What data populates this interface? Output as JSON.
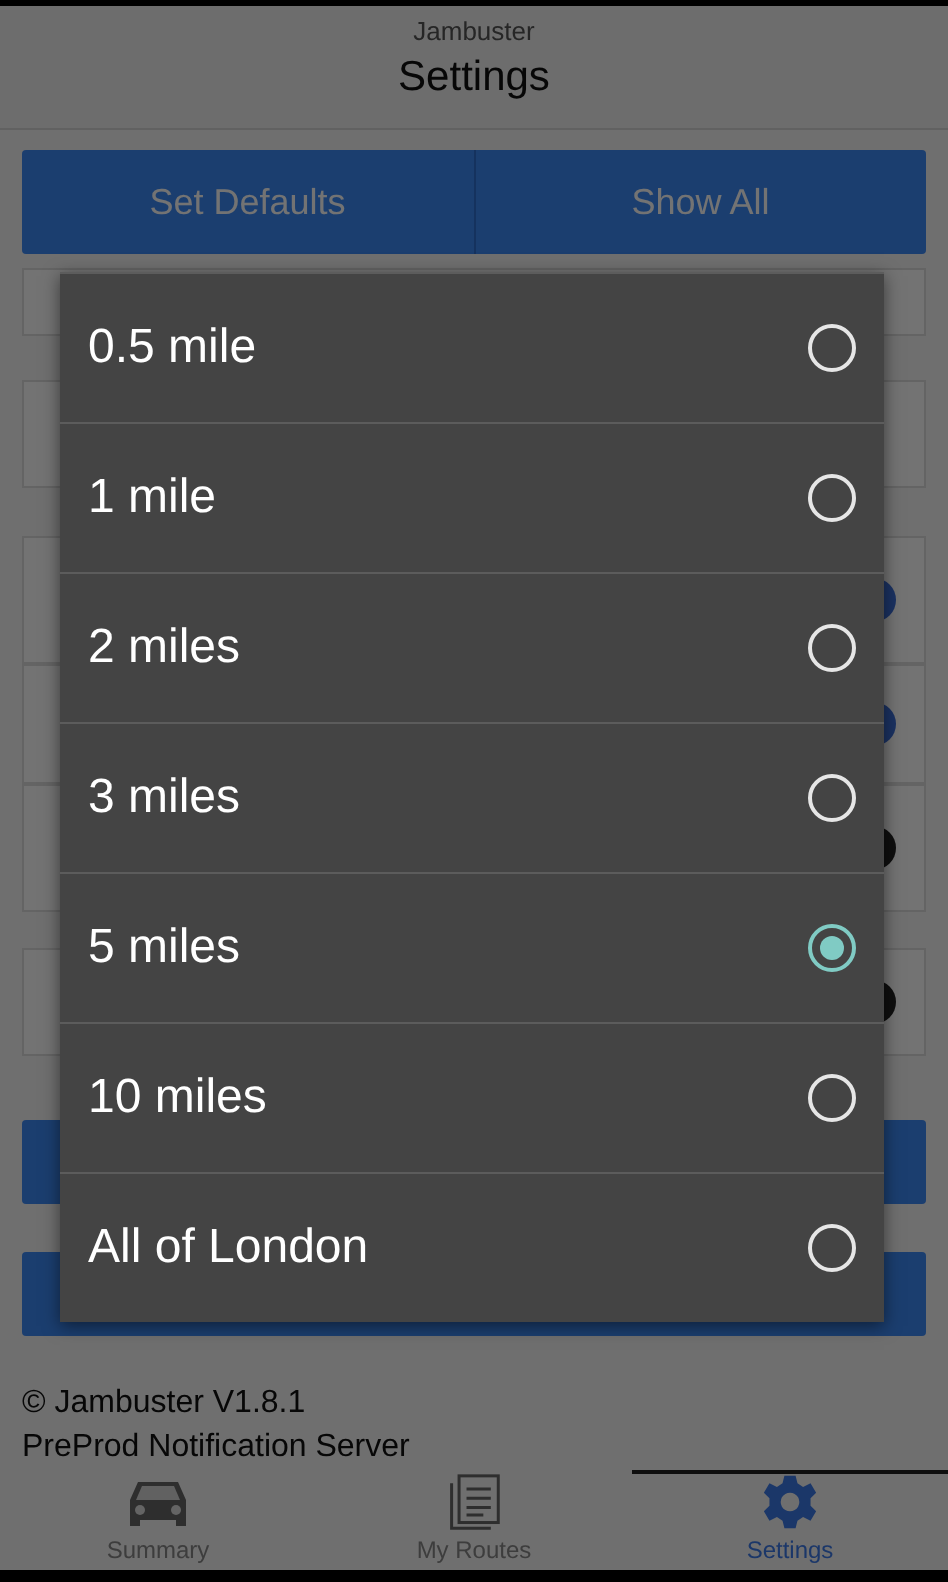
{
  "header": {
    "app_name": "Jambuster",
    "title": "Settings"
  },
  "actions": [
    "Set Defaults",
    "Show All"
  ],
  "settings_rows": [
    {
      "kind": "blank"
    },
    {
      "kind": "blank"
    },
    {
      "kind": "toggle",
      "on": true
    },
    {
      "kind": "toggle",
      "on": true
    },
    {
      "kind": "toggle",
      "on": false
    },
    {
      "kind": "toggle",
      "on": false
    },
    {
      "kind": "button"
    },
    {
      "kind": "button"
    }
  ],
  "footer": {
    "copyright": "© Jambuster V1.8.1",
    "server": "PreProd Notification Server"
  },
  "nav": [
    {
      "label": "Summary",
      "kind": "car",
      "selected": false
    },
    {
      "label": "My Routes",
      "kind": "list",
      "selected": false
    },
    {
      "label": "Settings",
      "kind": "gear",
      "selected": true
    }
  ],
  "dialog": {
    "options": [
      {
        "label": "0.5 mile",
        "selected": false
      },
      {
        "label": "1 mile",
        "selected": false
      },
      {
        "label": "2 miles",
        "selected": false
      },
      {
        "label": "3 miles",
        "selected": false
      },
      {
        "label": "5 miles",
        "selected": true
      },
      {
        "label": "10 miles",
        "selected": false
      },
      {
        "label": "All of London",
        "selected": false
      }
    ]
  }
}
